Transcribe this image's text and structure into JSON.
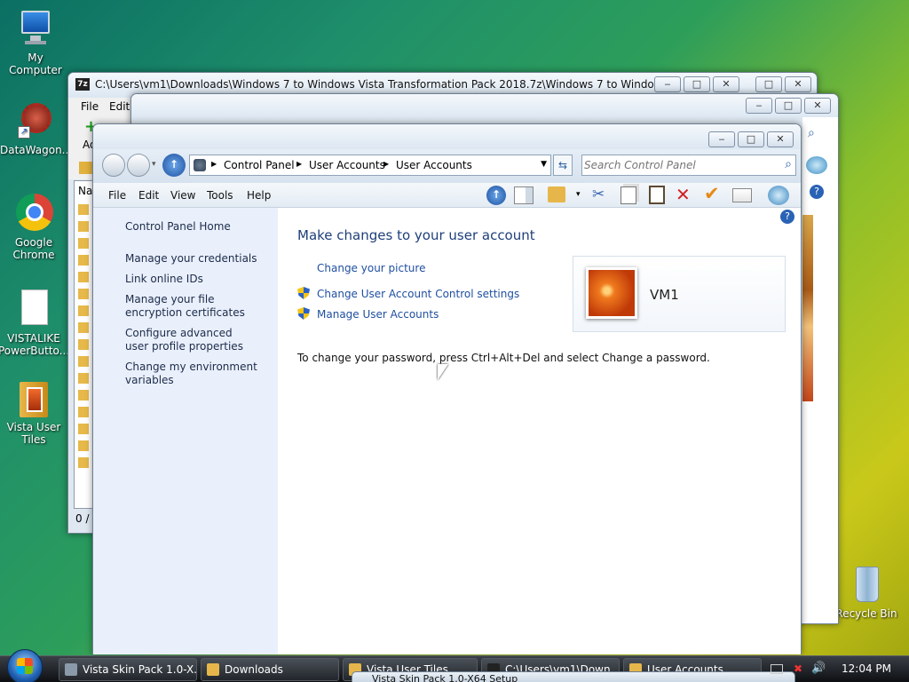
{
  "desktop_icons": [
    {
      "label": "My Computer"
    },
    {
      "label": "DataWagon..."
    },
    {
      "label": "Google Chrome"
    },
    {
      "label": "VISTALIKE PowerButto..."
    },
    {
      "label": "Vista User Tiles"
    },
    {
      "label": "Recycle Bin"
    }
  ],
  "back_window_1": {
    "title": "C:\\Users\\vm1\\Downloads\\Windows 7 to Windows Vista Transformation Pack 2018.7z\\Windows 7 to Windows Vista Tr...",
    "menu": [
      "File",
      "Edit"
    ],
    "toolbar_label": "Ad",
    "list_header": "Na",
    "status": "0 / 2"
  },
  "main_window": {
    "breadcrumb": [
      "Control Panel",
      "User Accounts",
      "User Accounts"
    ],
    "search_placeholder": "Search Control Panel",
    "menu": [
      "File",
      "Edit",
      "View",
      "Tools",
      "Help"
    ],
    "left_tasks": [
      "Control Panel Home",
      "Manage your credentials",
      "Link online IDs",
      "Manage your file encryption certificates",
      "Configure advanced user profile properties",
      "Change my environment variables"
    ],
    "heading": "Make changes to your user account",
    "links": [
      "Change your picture",
      "Change User Account Control settings",
      "Manage User Accounts"
    ],
    "user_name": "VM1",
    "password_note": "To change your password, press Ctrl+Alt+Del and select Change a password."
  },
  "taskbar": {
    "buttons": [
      "Vista Skin Pack 1.0-X...",
      "Downloads",
      "Vista User Tiles",
      "C:\\Users\\vm1\\Down...",
      "User Accounts"
    ],
    "setup_title": "Vista Skin Pack 1.0-X64 Setup",
    "clock": "12:04 PM"
  },
  "colors": {
    "link": "#1f4fa0",
    "heading": "#1e3f7a",
    "accent": "#3d6fb5"
  }
}
